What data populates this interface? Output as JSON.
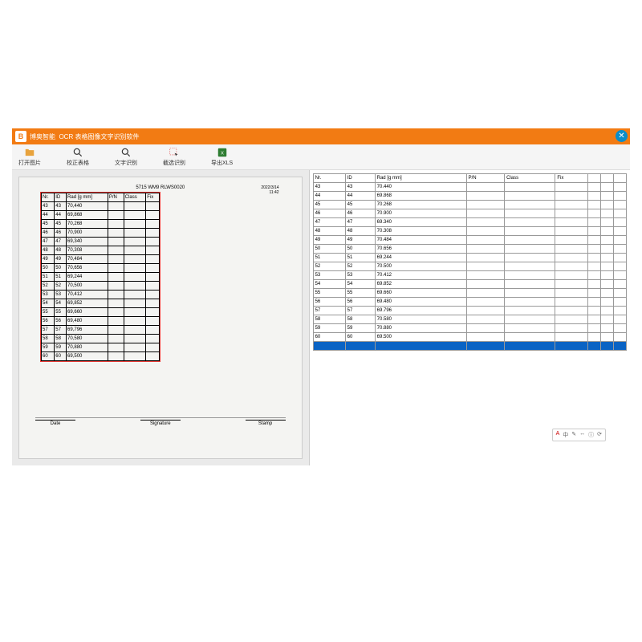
{
  "brand": "博奥智能",
  "app_title": "OCR 表格图像文字识别软件",
  "toolbar": {
    "open_image": "打开图片",
    "correct_table": "校正表格",
    "text_ocr": "文字识别",
    "crop_ocr": "截选识别",
    "export_xls": "导出XLS"
  },
  "scan": {
    "doc_code": "5715 WM9 RLWS0020",
    "date": "2022/3/14",
    "time": "11:42",
    "columns": [
      "Nr.",
      "ID",
      "Rad [g mm]",
      "P/N",
      "Class",
      "Fix"
    ],
    "footer": {
      "date": "Date",
      "signature": "Signature",
      "stamp": "Stamp"
    }
  },
  "right_columns": [
    "Nr.",
    "ID",
    "Rad [g mm]",
    "P/N",
    "Class",
    "Fix"
  ],
  "rows": [
    {
      "nr": "43",
      "id": "43",
      "rad": "70.440"
    },
    {
      "nr": "44",
      "id": "44",
      "rad": "69.868"
    },
    {
      "nr": "45",
      "id": "45",
      "rad": "70.268"
    },
    {
      "nr": "46",
      "id": "46",
      "rad": "70.900"
    },
    {
      "nr": "47",
      "id": "47",
      "rad": "69.340"
    },
    {
      "nr": "48",
      "id": "48",
      "rad": "70.308"
    },
    {
      "nr": "49",
      "id": "49",
      "rad": "70.484"
    },
    {
      "nr": "50",
      "id": "50",
      "rad": "70.656"
    },
    {
      "nr": "51",
      "id": "51",
      "rad": "69.244"
    },
    {
      "nr": "52",
      "id": "52",
      "rad": "70.500"
    },
    {
      "nr": "53",
      "id": "53",
      "rad": "70.412"
    },
    {
      "nr": "54",
      "id": "54",
      "rad": "69.852"
    },
    {
      "nr": "55",
      "id": "55",
      "rad": "69.660"
    },
    {
      "nr": "56",
      "id": "56",
      "rad": "69.480"
    },
    {
      "nr": "57",
      "id": "57",
      "rad": "69.796"
    },
    {
      "nr": "58",
      "id": "58",
      "rad": "70.580"
    },
    {
      "nr": "59",
      "id": "59",
      "rad": "70.880"
    },
    {
      "nr": "60",
      "id": "60",
      "rad": "69.500"
    }
  ],
  "mini_toolbar": [
    "A",
    "中",
    "✎",
    "↔",
    "ⓘ",
    "⟳"
  ]
}
